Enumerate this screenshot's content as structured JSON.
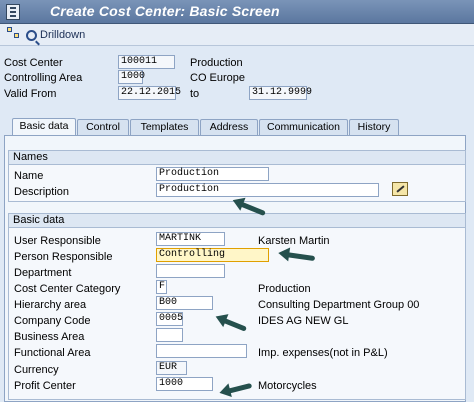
{
  "window": {
    "title": "Create Cost Center: Basic Screen"
  },
  "toolbar": {
    "drilldown_label": "Drilldown"
  },
  "header": {
    "cost_center": {
      "label": "Cost Center",
      "value": "100011",
      "text": "Production"
    },
    "controlling_area": {
      "label": "Controlling Area",
      "value": "1000",
      "text": "CO Europe"
    },
    "valid_from": {
      "label": "Valid From",
      "value": "22.12.2015",
      "to_label": "to",
      "to_value": "31.12.9999"
    }
  },
  "tabs": [
    "Basic data",
    "Control",
    "Templates",
    "Address",
    "Communication",
    "History"
  ],
  "names_group": {
    "title": "Names",
    "name": {
      "label": "Name",
      "value": "Production"
    },
    "description": {
      "label": "Description",
      "value": "Production"
    }
  },
  "basic_group": {
    "title": "Basic data",
    "user_responsible": {
      "label": "User Responsible",
      "value": "MARTINK",
      "text": "Karsten Martin"
    },
    "person_responsible": {
      "label": "Person Responsible",
      "value": "Controlling"
    },
    "department": {
      "label": "Department",
      "value": ""
    },
    "category": {
      "label": "Cost Center Category",
      "value": "F",
      "text": "Production"
    },
    "hierarchy": {
      "label": "Hierarchy area",
      "value": "B00",
      "text": "Consulting Department Group 00"
    },
    "company_code": {
      "label": "Company Code",
      "value": "0005",
      "text": "IDES AG NEW GL"
    },
    "business_area": {
      "label": "Business Area",
      "value": ""
    },
    "functional_area": {
      "label": "Functional Area",
      "value": "",
      "text": "Imp. expenses(not in P&L)"
    },
    "currency": {
      "label": "Currency",
      "value": "EUR"
    },
    "profit_center": {
      "label": "Profit Center",
      "value": "1000",
      "text": "Motorcycles"
    }
  },
  "icons": [
    "sap-window-icon",
    "tree-icon",
    "drilldown-icon",
    "edit-icon"
  ],
  "colors": {
    "title_bar": "#5b779f",
    "arrow": "#25504d",
    "highlight": "#fff6c8"
  }
}
